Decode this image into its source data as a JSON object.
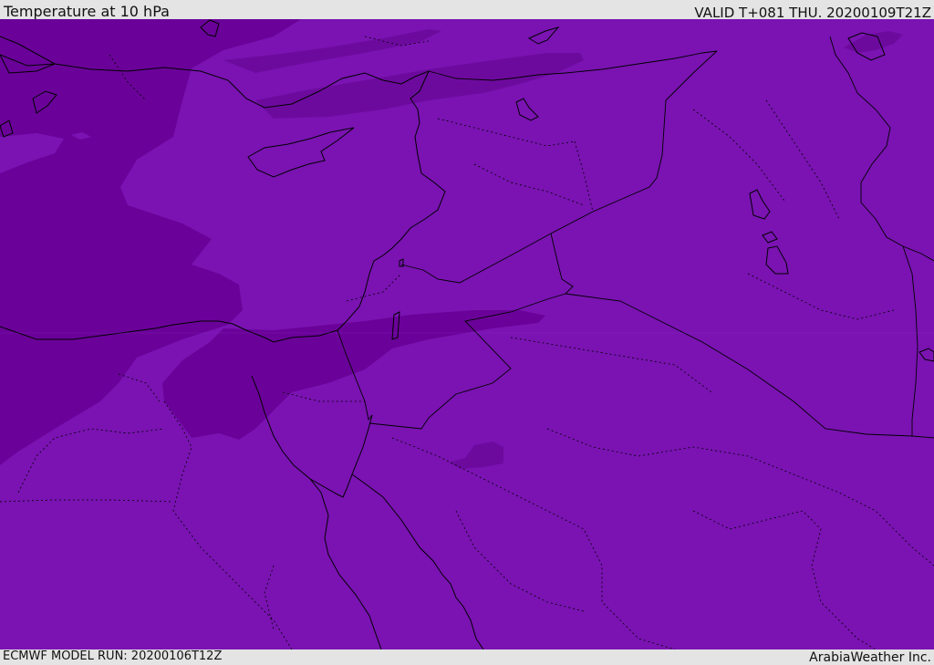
{
  "header": {
    "title": "Temperature at 10 hPa",
    "valid": "VALID T+081 THU. 20200109T21Z"
  },
  "footer": {
    "model_run": "ECMWF MODEL RUN: 20200106T12Z",
    "credit": "ArabiaWeather Inc."
  },
  "colors": {
    "field_main": "#7a13b2",
    "field_cold": "#6d0a9e",
    "field_cold2": "#6a0299",
    "coastline": "#000000",
    "bar_background": "#e4e4e4"
  }
}
